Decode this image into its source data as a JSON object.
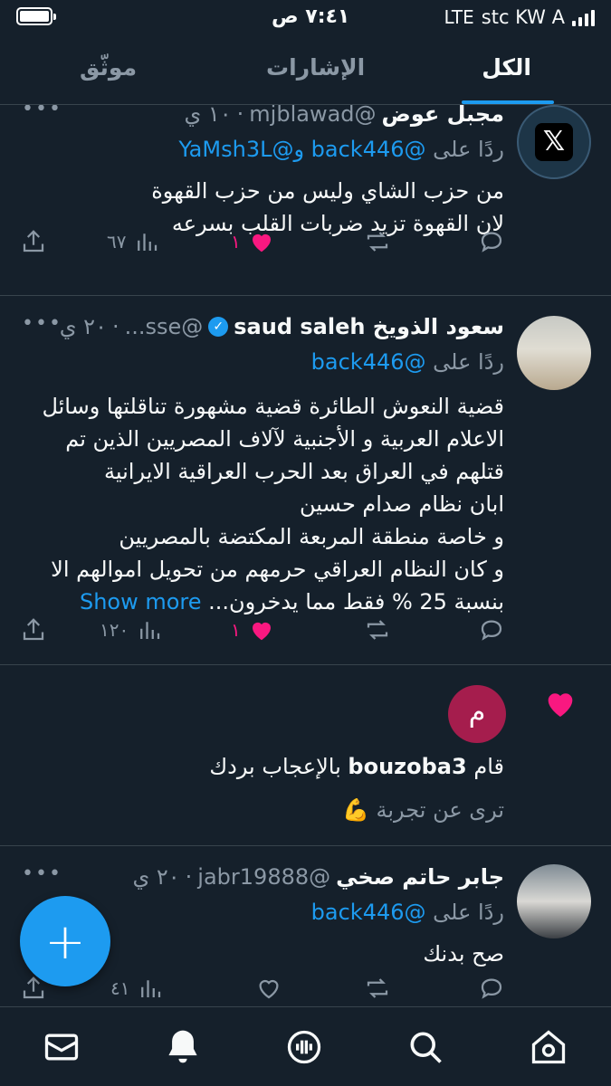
{
  "status_bar": {
    "carrier": "stc KW A",
    "network": "LTE",
    "time": "٧:٤١ ص"
  },
  "tabs": [
    {
      "label": "الكل",
      "active": true
    },
    {
      "label": "الإشارات",
      "active": false
    },
    {
      "label": "موثّق",
      "active": false
    }
  ],
  "posts": [
    {
      "name": "مجبل عوض",
      "handle": "@mjblawad",
      "time": "١٠ ي",
      "reply_prefix": "ردًا على",
      "mentions": "@back446 و@YaMsh3L",
      "lines": [
        "من حزب الشاي وليس من حزب القهوة",
        "لان القهوة تزيد ضربات القلب بسرعه"
      ],
      "likes": "١",
      "views": "٦٧",
      "avatar": "x-logo",
      "avatar_label": "x"
    },
    {
      "name": "سعود الذويخ saud saleh",
      "handle": "@sse...",
      "time": "٢٠ ي",
      "reply_prefix": "ردًا على",
      "mentions": "@back446",
      "lines": [
        "قضية النعوش الطائرة قضية مشهورة تناقلتها وسائل",
        "الاعلام العربية و الأجنبية  لآلاف المصريين الذين تم",
        "قتلهم في العراق بعد الحرب العراقية الايرانية",
        "ابان نظام صدام حسين",
        "و خاصة  منطقة المربعة  المكتضة بالمصريين",
        "و كان النظام العراقي حرمهم من تحويل اموالهم الا",
        "بنسبة 25 % فقط مما يدخرون..."
      ],
      "show_more": "Show more",
      "likes": "١",
      "views": "١٢٠"
    },
    {
      "name": "جابر حاتم صخي",
      "handle": "@jabr19888",
      "time": "٢٠ ي",
      "reply_prefix": "ردًا على",
      "mentions": "@back446",
      "lines": [
        "صح بدنك"
      ],
      "views": "٤١"
    }
  ],
  "like_notification": {
    "avatar_letter": "م",
    "prefix": "قام",
    "user": "bouzoba3",
    "suffix": "بالإعجاب بردك",
    "quote": "ترى عن تجربة 💪"
  },
  "fab_label": "+",
  "colors": {
    "accent": "#1d9bf0",
    "like": "#f91880",
    "background": "#15202b",
    "muted": "#8b98a5"
  },
  "bottom_nav": [
    "home-icon",
    "search-icon",
    "spaces-icon",
    "notifications-icon",
    "messages-icon"
  ]
}
